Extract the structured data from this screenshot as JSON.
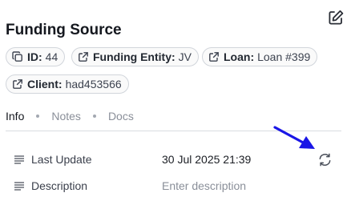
{
  "header": {
    "title": "Funding Source",
    "edit_icon": "edit-square-icon"
  },
  "chips": [
    {
      "icon": "copy-icon",
      "key": "ID:",
      "value": "44"
    },
    {
      "icon": "external-link-icon",
      "key": "Funding Entity:",
      "value": "JV"
    },
    {
      "icon": "external-link-icon",
      "key": "Loan:",
      "value": "Loan #399"
    },
    {
      "icon": "external-link-icon",
      "key": "Client:",
      "value": "had453566"
    }
  ],
  "tabs": [
    {
      "label": "Info",
      "active": true
    },
    {
      "label": "Notes",
      "active": false
    },
    {
      "label": "Docs",
      "active": false
    }
  ],
  "fields": [
    {
      "icon": "lines-icon",
      "label": "Last Update",
      "value": "30 Jul 2025 21:39"
    },
    {
      "icon": "lines-icon",
      "label": "Description",
      "placeholder": "Enter description"
    }
  ],
  "refresh_icon": "refresh-icon",
  "colors": {
    "annotation_arrow": "#1a16e6"
  }
}
